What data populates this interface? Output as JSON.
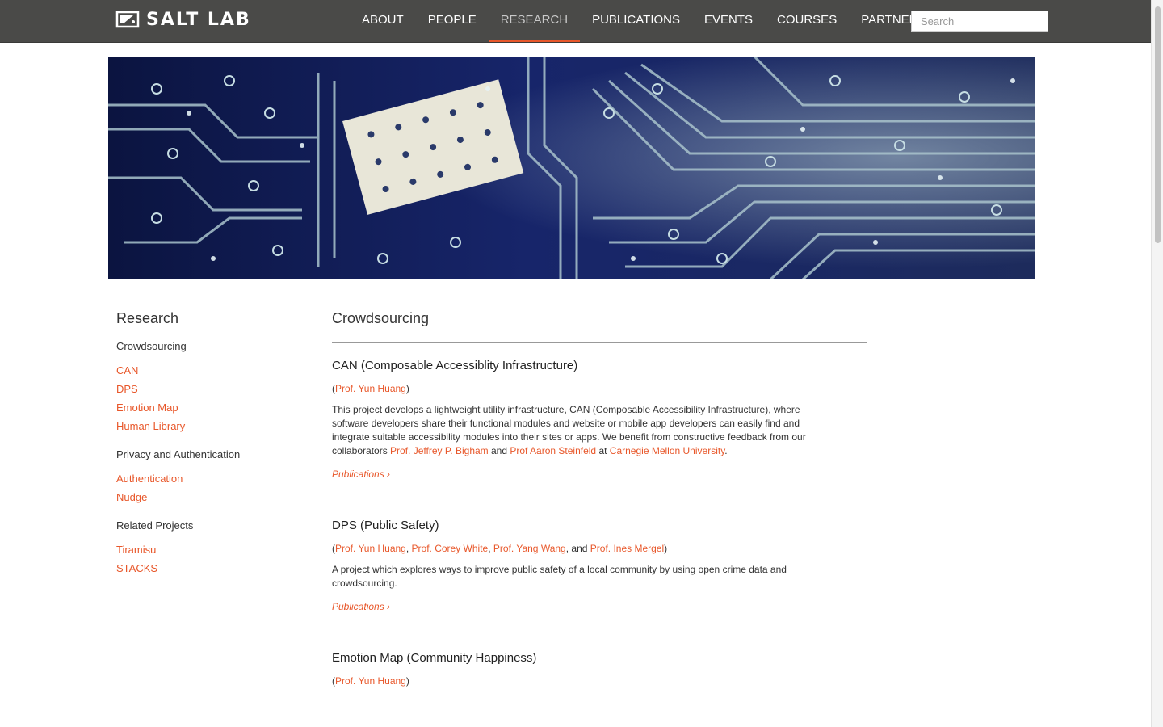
{
  "header": {
    "logo_text": "SALT LAB",
    "nav": [
      "ABOUT",
      "PEOPLE",
      "RESEARCH",
      "PUBLICATIONS",
      "EVENTS",
      "COURSES",
      "PARTNERSHIPS"
    ],
    "active_nav": "RESEARCH",
    "search_placeholder": "Search"
  },
  "colors": {
    "accent": "#e8572a",
    "nav_bg": "#4a4a48"
  },
  "sidebar": {
    "title": "Research",
    "groups": [
      {
        "label": "Crowdsourcing",
        "links": [
          "CAN",
          "DPS",
          "Emotion Map",
          "Human Library"
        ]
      },
      {
        "label": "Privacy and Authentication",
        "links": [
          "Authentication",
          "Nudge"
        ]
      },
      {
        "label": "Related Projects",
        "links": [
          "Tiramisu",
          "STACKS"
        ]
      }
    ]
  },
  "main": {
    "title": "Crowdsourcing",
    "projects": [
      {
        "title": "CAN (Composable Accessiblity Infrastructure)",
        "people": [
          "Prof. Yun Huang"
        ],
        "desc_parts": [
          "This project develops a lightweight utility infrastructure, CAN (Composable Accessibility Infrastructure), where software developers share their functional modules and website or mobile app developers can easily find and integrate suitable accessibility modules into their sites or apps. We benefit from constructive feedback from our collaborators ",
          "Prof. Jeffrey P. Bigham",
          " and ",
          "Prof Aaron Steinfeld",
          " at ",
          "Carnegie Mellon University",
          "."
        ],
        "pubs_label": "Publications ›"
      },
      {
        "title": "DPS (Public Safety)",
        "people": [
          "Prof. Yun Huang",
          "Prof. Corey White",
          "Prof. Yang Wang",
          "Prof. Ines Mergel"
        ],
        "desc": "A project which explores ways to improve public safety of a local community by using open crime data and crowdsourcing.",
        "pubs_label": "Publications ›"
      },
      {
        "title": "Emotion Map (Community Happiness)",
        "people": [
          "Prof. Yun Huang"
        ]
      }
    ]
  },
  "punct": {
    "open": "(",
    "close": ")",
    "comma": ", ",
    "and": ", and "
  }
}
